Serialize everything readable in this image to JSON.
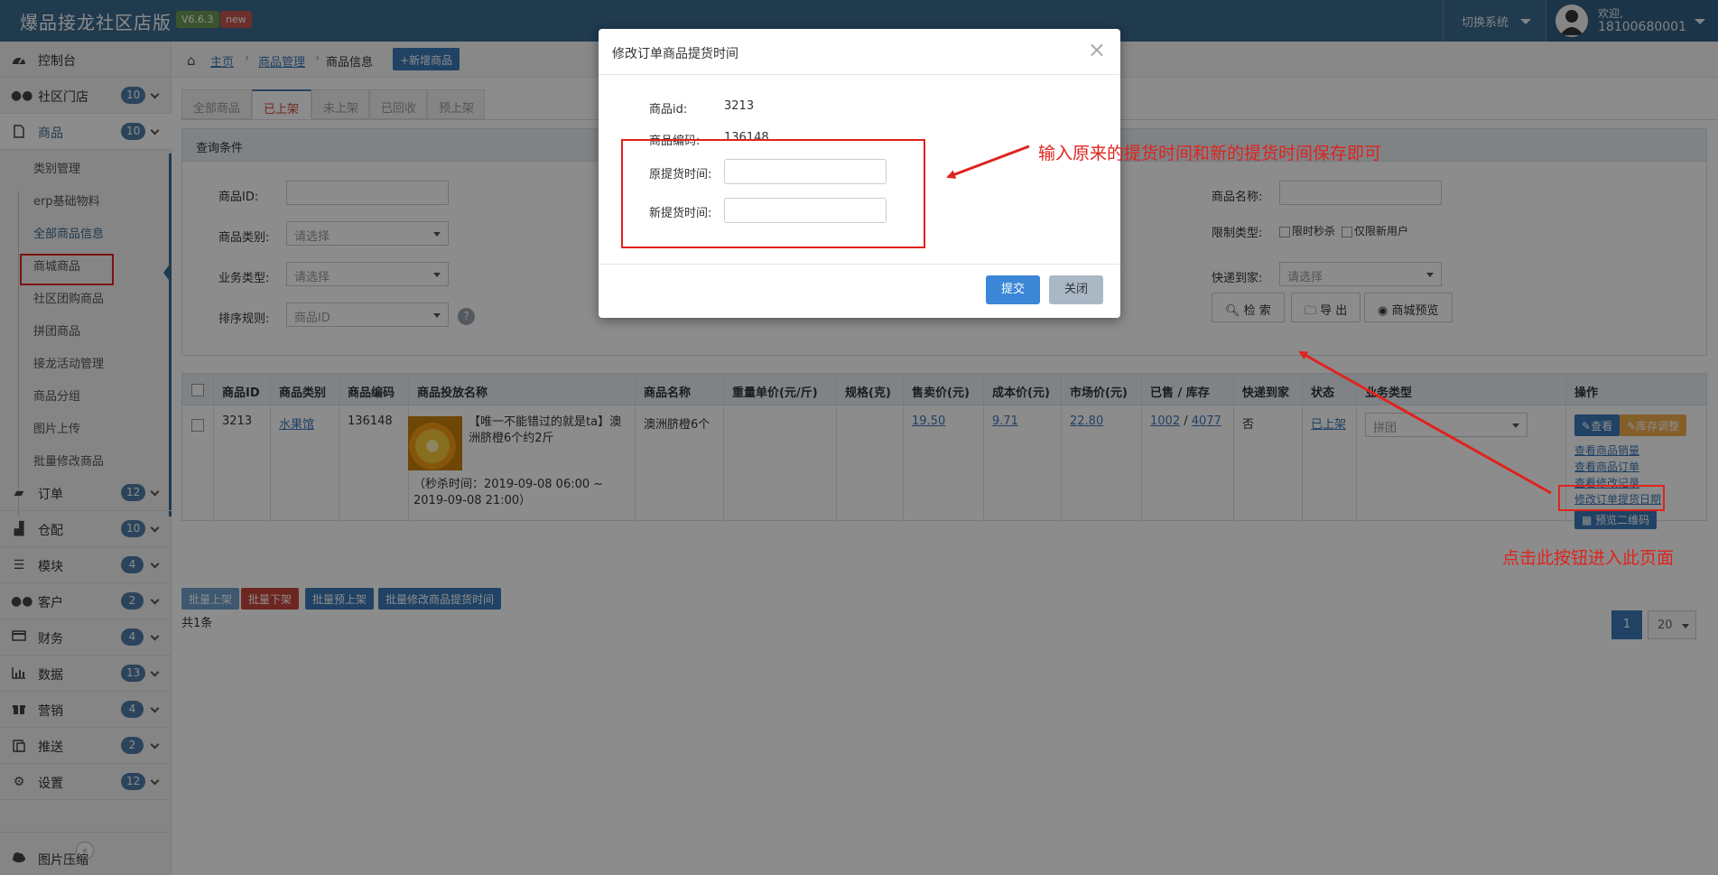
{
  "header": {
    "brand": "爆品接龙社区店版",
    "version": "V6.6.3",
    "new_tag": "new",
    "switch_system": "切换系统",
    "welcome": "欢迎,",
    "user_phone": "18100680001"
  },
  "sidebar": {
    "items": [
      {
        "label": "控制台",
        "icon": "dashboard-icon",
        "count": ""
      },
      {
        "label": "社区门店",
        "icon": "users-icon",
        "count": "10"
      },
      {
        "label": "商品",
        "icon": "file-icon",
        "count": "10"
      },
      {
        "label": "订单",
        "icon": "book-icon",
        "count": "12"
      },
      {
        "label": "仓配",
        "icon": "truck-icon",
        "count": "10"
      },
      {
        "label": "模块",
        "icon": "list-icon",
        "count": "4"
      },
      {
        "label": "客户",
        "icon": "users-icon",
        "count": "2"
      },
      {
        "label": "财务",
        "icon": "card-icon",
        "count": "4"
      },
      {
        "label": "数据",
        "icon": "chart-icon",
        "count": "13"
      },
      {
        "label": "营销",
        "icon": "gift-icon",
        "count": "4"
      },
      {
        "label": "推送",
        "icon": "paste-icon",
        "count": "2"
      },
      {
        "label": "设置",
        "icon": "gears-icon",
        "count": "12"
      }
    ],
    "sub_items": [
      "类别管理",
      "erp基础物料",
      "全部商品信息",
      "商城商品",
      "社区团购商品",
      "拼团商品",
      "接龙活动管理",
      "商品分组",
      "图片上传",
      "批量修改商品"
    ],
    "bottom_item": "图片压缩"
  },
  "breadcrumb": {
    "home": "主页",
    "level1": "商品管理",
    "level2": "商品信息",
    "add_button": "+新增商品"
  },
  "tabs": [
    "全部商品",
    "已上架",
    "未上架",
    "已回收",
    "预上架"
  ],
  "query": {
    "title": "查询条件",
    "product_id_label": "商品ID:",
    "category_label": "商品类别:",
    "category_value": "请选择",
    "business_type_label": "业务类型:",
    "business_type_value": "请选择",
    "sort_label": "排序规则:",
    "sort_value": "商品ID",
    "name_label": "商品名称:",
    "limit_type_label": "限制类型:",
    "limit_opt1": "限时秒杀",
    "limit_opt2": "仅限新用户",
    "delivery_label": "快递到家:",
    "delivery_value": "请选择",
    "search_button": "检 索",
    "export_button": "导 出",
    "preview_button": "商城预览"
  },
  "table": {
    "headers": [
      "商品ID",
      "商品类别",
      "商品编码",
      "商品投放名称",
      "商品名称",
      "重量单价(元/斤)",
      "规格(克)",
      "售卖价(元)",
      "成本价(元)",
      "市场价(元)",
      "已售 / 库存",
      "快递到家",
      "状态",
      "业务类型",
      "操作"
    ],
    "row": {
      "id": "3213",
      "category": "水果馆",
      "code": "136148",
      "title": "【唯一不能错过的就是ta】澳洲脐橙6个约2斤",
      "seckill": "（秒杀时间：2019-09-08 06:00 ~ 2019-09-08 21:00）",
      "name": "澳洲脐橙6个",
      "price": "19.50",
      "cost": "9.71",
      "market": "22.80",
      "sold": "1002",
      "stock": "4077",
      "delivery": "否",
      "status": "已上架",
      "biz_type": "拼团"
    },
    "actions": {
      "view": "查看",
      "stock_adjust": "库存调整",
      "sales": "查看商品销量",
      "orders": "查看商品订单",
      "history": "查看修改记录",
      "modify_date": "修改订单提货日期",
      "qrcode": "预览二维码"
    }
  },
  "batch_buttons": [
    "批量上架",
    "批量下架",
    "批量预上架",
    "批量修改商品提货时间"
  ],
  "total_text": "共1条",
  "pagination": {
    "page": "1",
    "page_size": "20"
  },
  "modal": {
    "title": "修改订单商品提货时间",
    "product_id_label": "商品id:",
    "product_id": "3213",
    "product_code_label": "商品编码:",
    "product_code": "136148",
    "old_time_label": "原提货时间:",
    "new_time_label": "新提货时间:",
    "submit": "提交",
    "close": "关闭"
  },
  "annotations": {
    "top": "输入原来的提货时间和新的提货时间保存即可",
    "bottom": "点击此按钮进入此页面"
  },
  "colors": {
    "header": "#3b6a8f",
    "primary": "#3b78b7",
    "danger": "#c9463d",
    "annotation": "#e0231e",
    "warning": "#f0ad4e"
  }
}
